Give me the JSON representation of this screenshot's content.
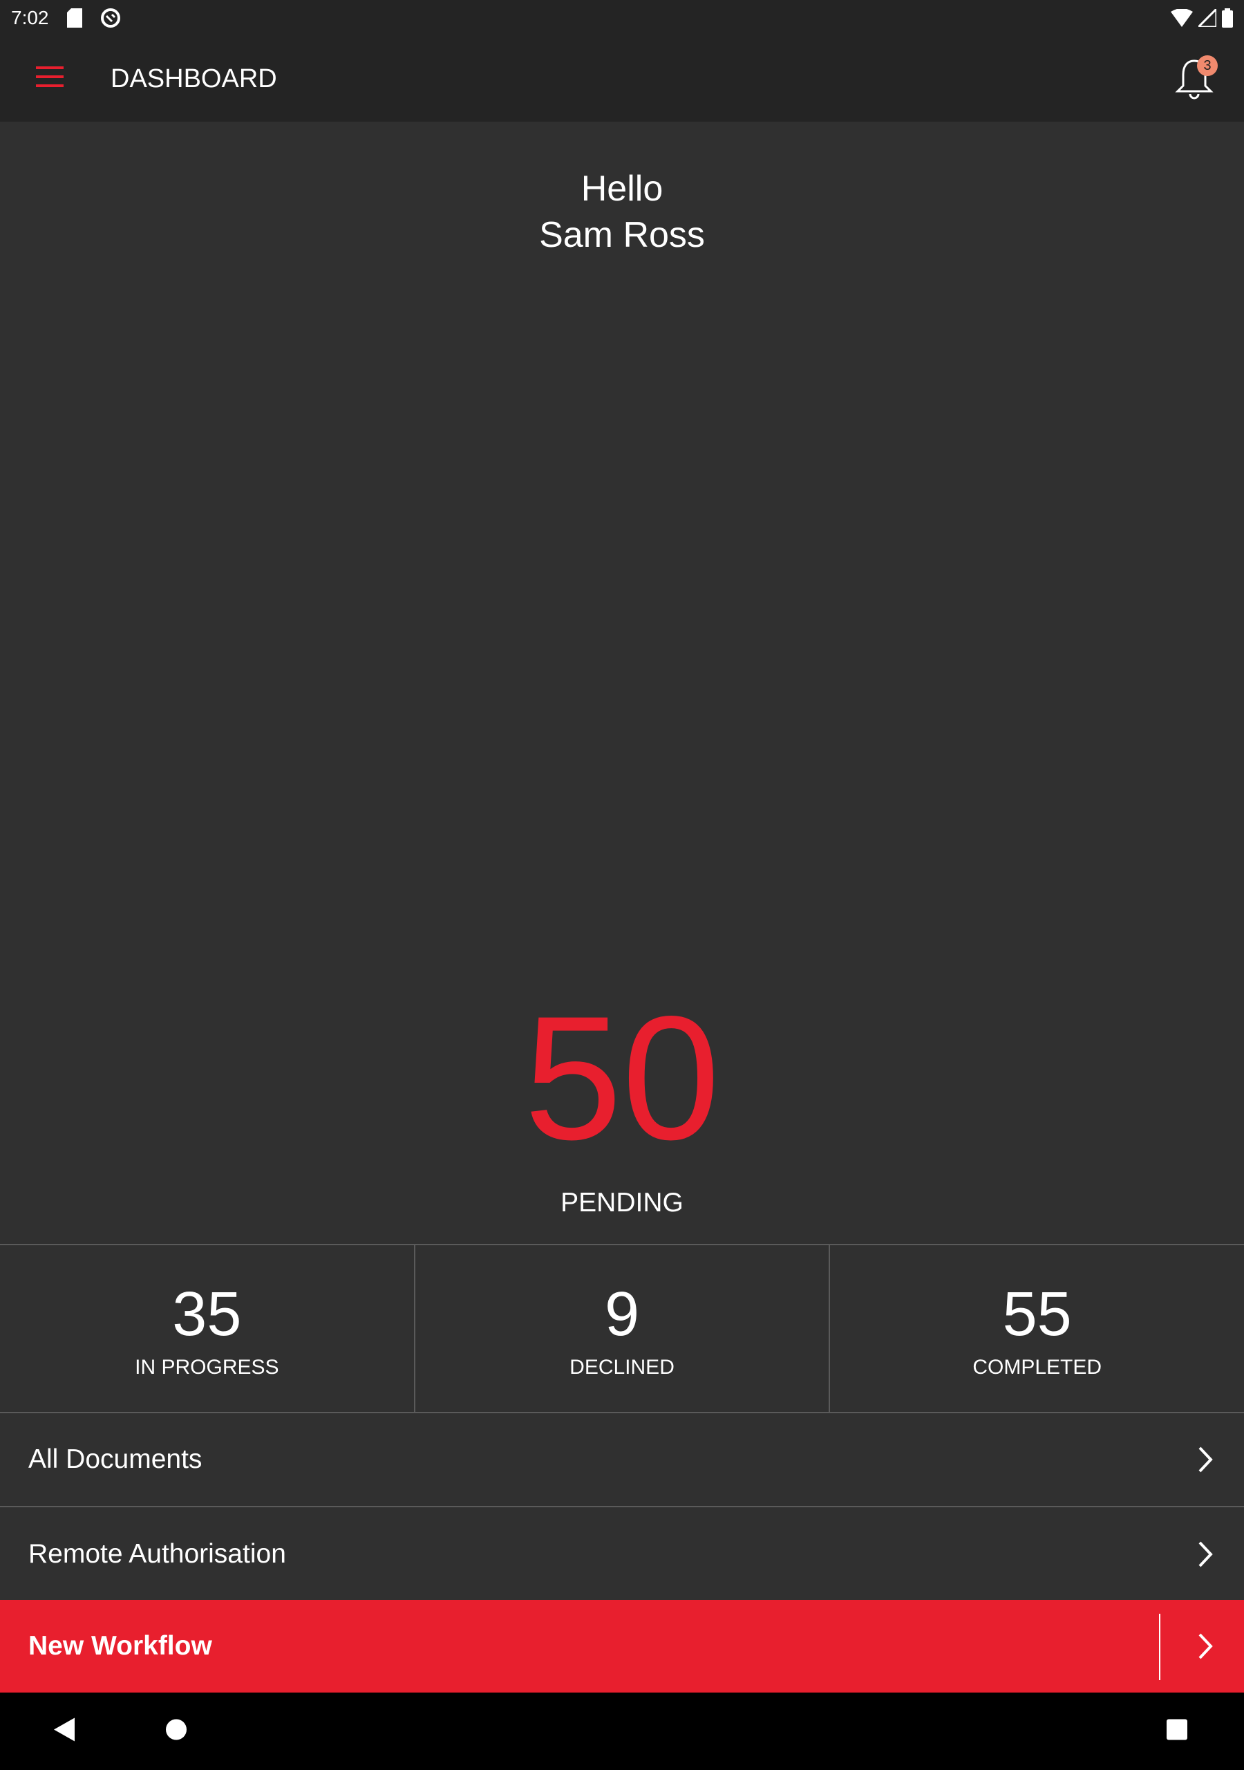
{
  "status_bar": {
    "time": "7:02",
    "icons": [
      "sd-card-icon",
      "sync-icon",
      "wifi-icon",
      "signal-icon",
      "battery-icon"
    ]
  },
  "app_bar": {
    "title": "DASHBOARD",
    "notification_count": "3",
    "accent": "#e81f2e"
  },
  "greeting": {
    "line1": "Hello",
    "line2": "Sam Ross"
  },
  "pending": {
    "count": "50",
    "label": "PENDING"
  },
  "stats": [
    {
      "count": "35",
      "label": "IN PROGRESS"
    },
    {
      "count": "9",
      "label": "DECLINED"
    },
    {
      "count": "55",
      "label": "COMPLETED"
    }
  ],
  "menu": [
    {
      "label": "All Documents"
    },
    {
      "label": "Remote Authorisation"
    },
    {
      "label": "New Workflow"
    }
  ],
  "nav": {
    "icons": [
      "back-icon",
      "home-icon",
      "recents-icon"
    ]
  }
}
